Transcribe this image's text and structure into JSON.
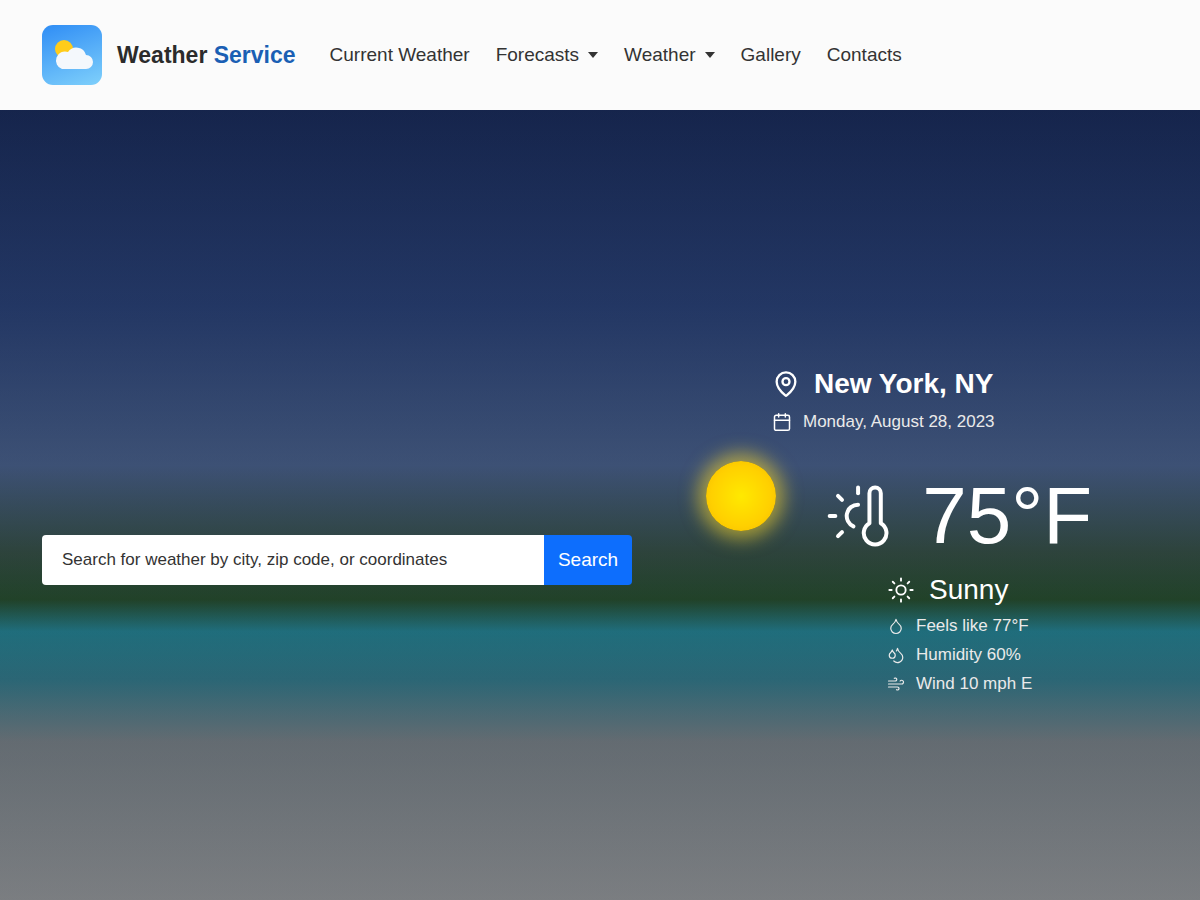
{
  "header": {
    "logo": {
      "brand": "Weather",
      "accent": "Service"
    },
    "nav": [
      {
        "label": "Current Weather",
        "dropdown": false
      },
      {
        "label": "Forecasts",
        "dropdown": true
      },
      {
        "label": "Weather",
        "dropdown": true
      },
      {
        "label": "Gallery",
        "dropdown": false
      },
      {
        "label": "Contacts",
        "dropdown": false
      }
    ]
  },
  "search": {
    "placeholder": "Search for weather by city, zip code, or coordinates",
    "button": "Search"
  },
  "weather": {
    "location": "New York, NY",
    "date": "Monday, August 28, 2023",
    "temperature": "75°F",
    "condition": "Sunny",
    "details": [
      {
        "kind": "feels",
        "text": "Feels like 77°F"
      },
      {
        "kind": "humidity",
        "text": "Humidity 60%"
      },
      {
        "kind": "wind",
        "text": "Wind 10 mph E"
      }
    ]
  }
}
